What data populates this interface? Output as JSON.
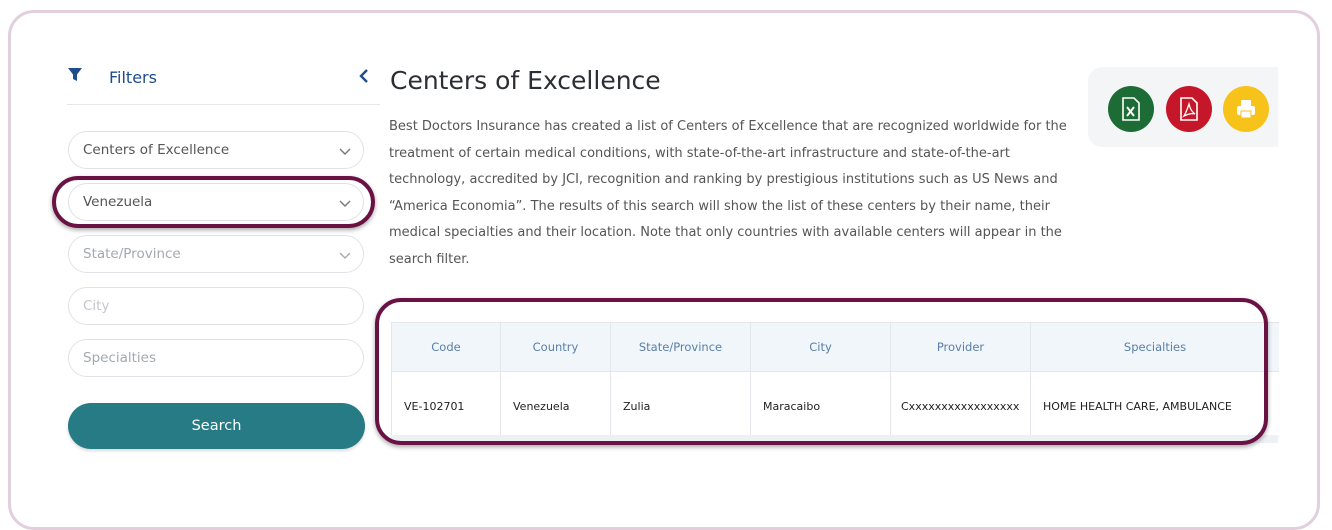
{
  "sidebar": {
    "title": "Filters",
    "program_select": "Centers of Excellence",
    "country_select": "Venezuela",
    "state_placeholder": "State/Province",
    "city_placeholder": "City",
    "specialties_placeholder": "Specialties",
    "search_label": "Search"
  },
  "main": {
    "title": "Centers of Excellence",
    "description": "Best Doctors Insurance has created a list of Centers of Excellence that are recognized worldwide for the treatment of certain medical conditions, with state-of-the-art infrastructure and state-of-the-art technology, accredited by JCI, recognition and ranking by prestigious institutions such as US News and “America Economia”. The results of this search will show the list of these centers by their name, their medical specialties and their location. Note that only countries with available centers will appear in the search filter."
  },
  "export": {
    "excel_icon": "excel-file-icon",
    "pdf_icon": "pdf-file-icon",
    "print_icon": "printer-icon",
    "colors": {
      "excel": "#1d6b35",
      "pdf": "#c6172a",
      "print": "#f7c21a"
    }
  },
  "table": {
    "headers": [
      "Code",
      "Country",
      "State/Province",
      "City",
      "Provider",
      "Specialties"
    ],
    "rows": [
      [
        "VE-102701",
        "Venezuela",
        "Zulia",
        "Maracaibo",
        "Cxxxxxxxxxxxxxxxxx",
        "HOME HEALTH CARE, AMBULANCE"
      ]
    ]
  },
  "colors": {
    "accent": "#277b85",
    "highlight": "#6b1245",
    "title_blue": "#1f4d8c"
  }
}
